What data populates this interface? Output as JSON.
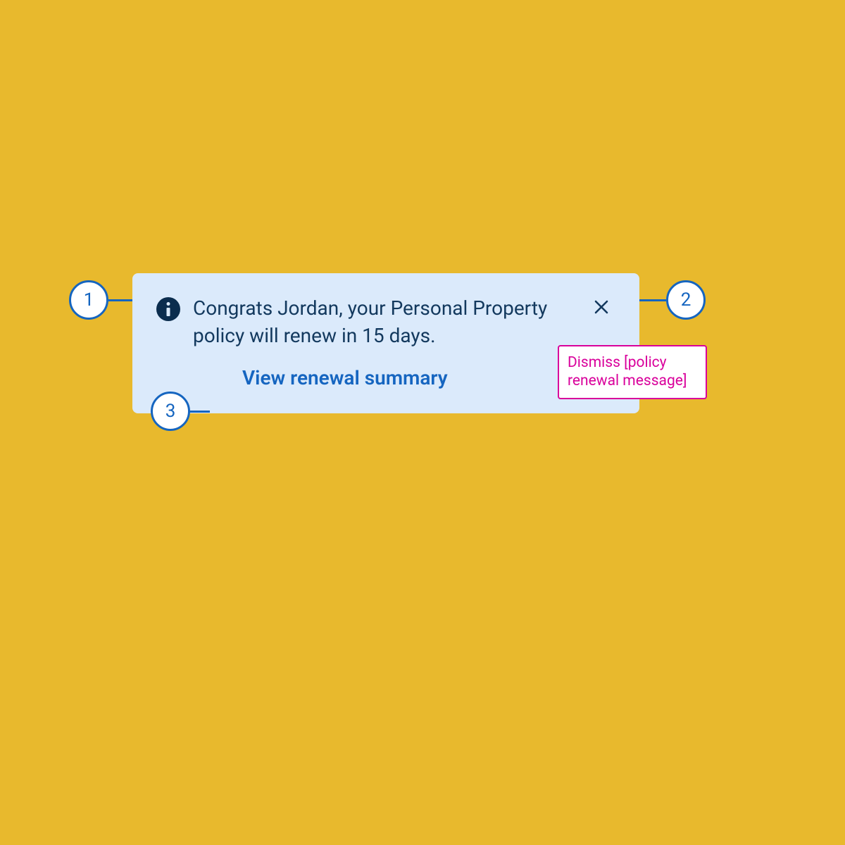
{
  "colors": {
    "page_bg": "#e8b92d",
    "card_bg": "#dbeafb",
    "text_dark": "#13395e",
    "link_blue": "#1565c0",
    "accent_magenta": "#d9009b",
    "info_icon_bg": "#0b2d4e"
  },
  "notification": {
    "message": "Congrats Jordan, your Personal Property policy will renew in 15 days.",
    "action_label": "View renewal summary"
  },
  "annotations": {
    "circle_1": "1",
    "circle_2": "2",
    "circle_3": "3",
    "tooltip_text": "Dismiss [policy renewal message]"
  }
}
